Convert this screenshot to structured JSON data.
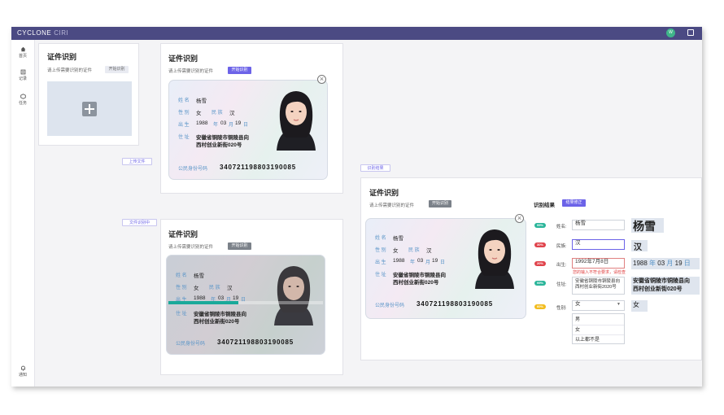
{
  "app": {
    "brand": "CYCLONE",
    "brand_sub": "CIRI",
    "avatar_text": "W"
  },
  "sidebar": {
    "items": [
      {
        "label": "首页"
      },
      {
        "label": "记录"
      },
      {
        "label": "任务"
      },
      {
        "label": "通知"
      }
    ]
  },
  "card1": {
    "title": "证件识别",
    "hint": "请上传需要识别的证件",
    "start_btn": "开始识别"
  },
  "card2": {
    "title": "证件识别",
    "hint": "请上传需要识别的证件",
    "start_btn": "开始识别"
  },
  "card3": {
    "title": "证件识别",
    "hint": "请上传需要识别的证件",
    "start_btn": "开始识别"
  },
  "card4": {
    "title": "证件识别",
    "hint": "请上传需要识别的证件",
    "start_btn": "开始识别",
    "result_title": "识别结果",
    "fix_btn": "结果修正"
  },
  "step_labels": {
    "upload": "上传文件",
    "recognizing": "文件识别中",
    "result": "识别结果"
  },
  "id_card": {
    "name_label": "姓  名",
    "name": "杨雪",
    "gender_label": "性  别",
    "gender": "女",
    "ethnic_label": "民  族",
    "ethnic": "汉",
    "birth_label": "出  生",
    "year": "1988",
    "year_unit": "年",
    "month": "03",
    "month_unit": "月",
    "day": "19",
    "day_unit": "日",
    "addr_label": "住  址",
    "addr1": "安徽省铜陵市铜陵县向",
    "addr2": "西村创业新街020号",
    "id_label": "公民身份号码",
    "id_number": "340721198803190085"
  },
  "scan": {
    "progress": 0.45
  },
  "fields": [
    {
      "badge": "95%",
      "badge_color": "#2ab59a",
      "label": "姓名:",
      "value": "杨雪",
      "crop": "杨雪"
    },
    {
      "badge": "30%",
      "badge_color": "#e0434b",
      "label": "民族:",
      "value": "汉",
      "crop": "汉"
    },
    {
      "badge": "20%",
      "badge_color": "#e0434b",
      "label": "出生:",
      "value": "1992年7月8日",
      "error": "您的输入不符合要求，请检查",
      "crop_year": "1988",
      "crop_year_unit": "年",
      "crop_month": "03",
      "crop_month_unit": "月",
      "crop_day": "19",
      "crop_day_unit": "日"
    },
    {
      "badge": "95%",
      "badge_color": "#2ab59a",
      "label": "住址:",
      "value": "安徽省铜陵市铜陵县向西村创业新街2020号",
      "crop1": "安徽省铜陵市铜陵县向",
      "crop2": "西村创业新街020号"
    },
    {
      "badge": "60%",
      "badge_color": "#f2bc1e",
      "label": "性别:",
      "value": "女",
      "crop": "女",
      "options": [
        "男",
        "女",
        "以上都不是"
      ]
    }
  ]
}
